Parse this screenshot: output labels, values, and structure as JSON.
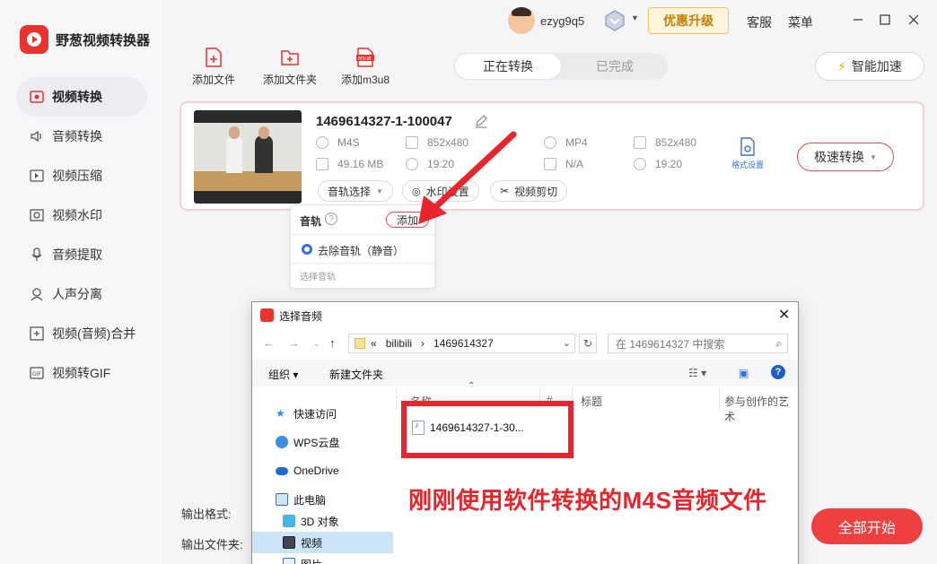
{
  "app": {
    "name": "野葱视频转换器"
  },
  "sidebar": {
    "items": [
      {
        "label": "视频转换",
        "icon": "video-convert-icon"
      },
      {
        "label": "音频转换",
        "icon": "audio-convert-icon"
      },
      {
        "label": "视频压缩",
        "icon": "video-compress-icon"
      },
      {
        "label": "视频水印",
        "icon": "watermark-icon"
      },
      {
        "label": "音频提取",
        "icon": "audio-extract-icon"
      },
      {
        "label": "人声分离",
        "icon": "vocal-separate-icon"
      },
      {
        "label": "视频(音频)合并",
        "icon": "merge-icon"
      },
      {
        "label": "视频转GIF",
        "icon": "gif-icon"
      }
    ],
    "active_index": 0
  },
  "titlebar": {
    "username": "ezyg9q5",
    "promo": "优惠升级",
    "service": "客服",
    "menu": "菜单"
  },
  "toolbar": {
    "add_file": "添加文件",
    "add_folder": "添加文件夹",
    "add_m3u8": "添加m3u8",
    "tab_converting": "正在转换",
    "tab_done": "已完成",
    "accelerate": "智能加速"
  },
  "task": {
    "filename": "1469614327-1-100047",
    "source": {
      "format": "M4S",
      "resolution": "852x480",
      "size": "49.16 MB",
      "duration": "19:20"
    },
    "target": {
      "format": "MP4",
      "resolution": "852x480",
      "size": "N/A",
      "duration": "19:20"
    },
    "audio_select": "音轨选择",
    "watermark": "水印设置",
    "cut": "视频剪切",
    "format_settings": "格式设置",
    "fast_convert": "极速转换"
  },
  "audio_popup": {
    "title": "音轨",
    "add": "添加",
    "option": "去除音轨（静音）",
    "hint": "选择音轨"
  },
  "bottom": {
    "output_format": "输出格式:",
    "output_folder": "输出文件夹:",
    "start_all": "全部开始"
  },
  "dialog": {
    "title": "选择音频",
    "path": [
      "«",
      "bilibili",
      "›",
      "1469614327"
    ],
    "search_placeholder": "在 1469614327 中搜索",
    "organize": "组织 ▾",
    "new_folder": "新建文件夹",
    "tree": [
      {
        "label": "快速访问",
        "icon": "star-icon"
      },
      {
        "label": "WPS云盘",
        "icon": "cloud-icon"
      },
      {
        "label": "OneDrive",
        "icon": "onedrive-icon"
      },
      {
        "label": "此电脑",
        "icon": "computer-icon"
      },
      {
        "label": "3D 对象",
        "icon": "3d-objects-icon"
      },
      {
        "label": "视频",
        "icon": "video-folder-icon"
      },
      {
        "label": "图片",
        "icon": "picture-folder-icon"
      }
    ],
    "selected_tree_index": 5,
    "columns": [
      "名称",
      "#",
      "标题",
      "参与创作的艺术"
    ],
    "file": "1469614327-1-30..."
  },
  "annotation": "刚刚使用软件转换的M4S音频文件",
  "colors": {
    "accent": "#ef3f3f",
    "highlight": "#e8242c",
    "link": "#3a6fd8"
  }
}
